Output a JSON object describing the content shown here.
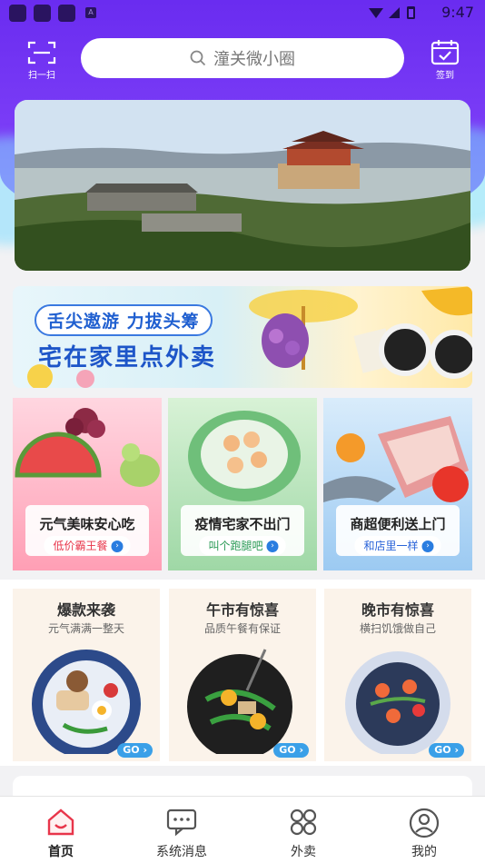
{
  "status_bar": {
    "time": "9:47",
    "notif_letter": "A"
  },
  "header": {
    "scan_label": "扫一扫",
    "search_placeholder": "潼关微小圈",
    "sign_label": "签到"
  },
  "promo": {
    "tagline": "舌尖遨游 力拔头筹",
    "headline": "宅在家里点外卖"
  },
  "categories": [
    {
      "title": "元气美味安心吃",
      "subtitle": "低价霸王餐",
      "accent": "#e8354a"
    },
    {
      "title": "疫情宅家不出门",
      "subtitle": "叫个跑腿吧",
      "accent": "#2a9a55"
    },
    {
      "title": "商超便利送上门",
      "subtitle": "和店里一样",
      "accent": "#2a63d8"
    }
  ],
  "meals": [
    {
      "title": "爆款来袭",
      "subtitle": "元气满满一整天",
      "go": "GO"
    },
    {
      "title": "午市有惊喜",
      "subtitle": "品质午餐有保证",
      "go": "GO"
    },
    {
      "title": "晚市有惊喜",
      "subtitle": "横扫饥饿做自己",
      "go": "GO"
    }
  ],
  "tabs": [
    {
      "label": "首页",
      "active": true
    },
    {
      "label": "系统消息",
      "active": false
    },
    {
      "label": "外卖",
      "active": false
    },
    {
      "label": "我的",
      "active": false
    }
  ],
  "colors": {
    "brand_purple": "#7a3cf6",
    "active_tab": "#e8354a",
    "go_blue": "#3aa0e8"
  }
}
